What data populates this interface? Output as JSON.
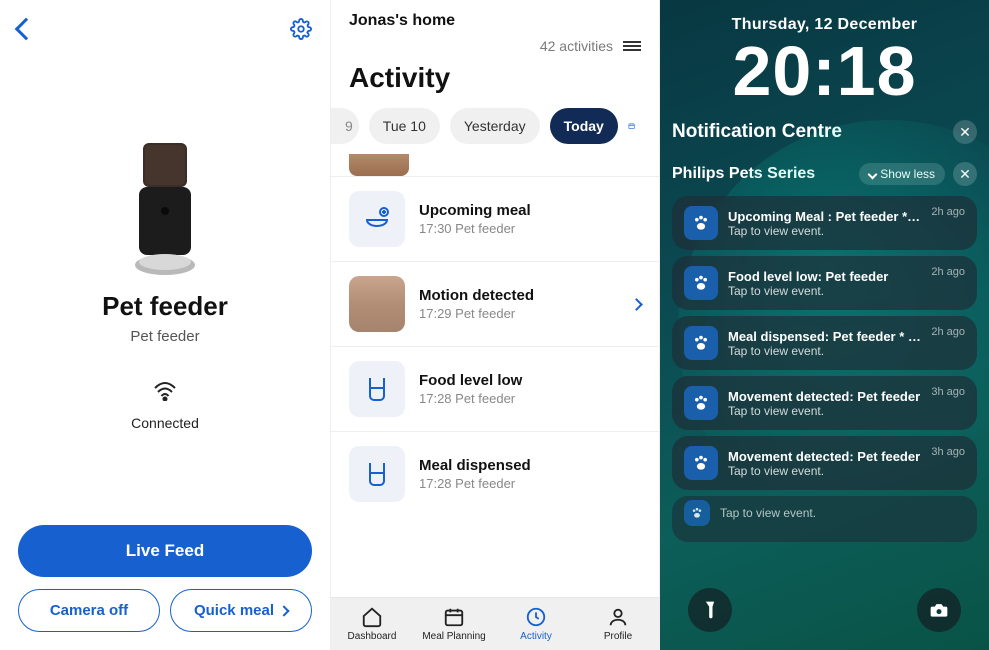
{
  "left": {
    "title": "Pet feeder",
    "subtitle": "Pet feeder",
    "status": "Connected",
    "live_feed": "Live Feed",
    "camera_off": "Camera off",
    "quick_meal": "Quick meal"
  },
  "mid": {
    "home_label": "Jonas's home",
    "count_label": "42 activities",
    "title": "Activity",
    "dates": {
      "edge": "9",
      "d1": "Tue 10",
      "d2": "Yesterday",
      "d3": "Today"
    },
    "items": [
      {
        "title": "Upcoming meal",
        "sub": "17:30 Pet feeder",
        "icon": "bowl"
      },
      {
        "title": "Motion detected",
        "sub": "17:29 Pet feeder",
        "icon": "photo",
        "chev": true
      },
      {
        "title": "Food level low",
        "sub": "17:28 Pet feeder",
        "icon": "cup"
      },
      {
        "title": "Meal dispensed",
        "sub": "17:28 Pet feeder",
        "icon": "cup"
      }
    ],
    "tabs": {
      "dashboard": "Dashboard",
      "meal": "Meal Planning",
      "activity": "Activity",
      "profile": "Profile"
    }
  },
  "right": {
    "date": "Thursday, 12 December",
    "time": "20:18",
    "nc": "Notification Centre",
    "app": "Philips Pets Series",
    "show_less": "Show less",
    "notifs": [
      {
        "title": "Upcoming Meal : Pet feeder * 5...",
        "sub": "Tap to view event.",
        "time": "2h ago"
      },
      {
        "title": "Food level low: Pet feeder",
        "sub": "Tap to view event.",
        "time": "2h ago"
      },
      {
        "title": "Meal dispensed: Pet feeder * sc...",
        "sub": "Tap to view event.",
        "time": "2h ago"
      },
      {
        "title": "Movement detected: Pet feeder",
        "sub": "Tap to view event.",
        "time": "3h ago"
      },
      {
        "title": "Movement detected: Pet feeder",
        "sub": "Tap to view event.",
        "time": "3h ago"
      }
    ],
    "partial_sub": "Tap to view event."
  }
}
